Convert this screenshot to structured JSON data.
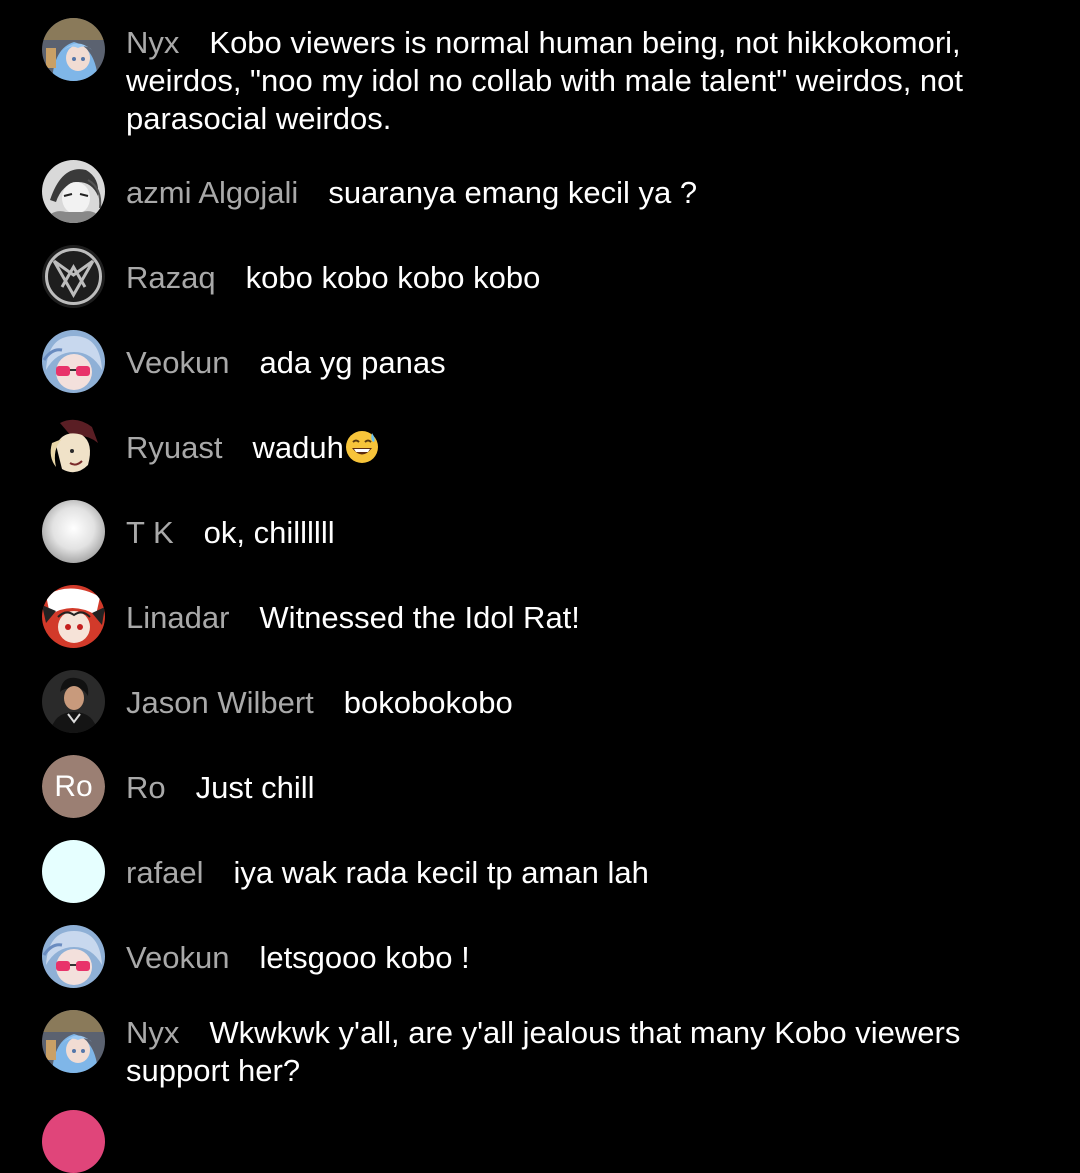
{
  "chat": {
    "messages": [
      {
        "author": "Nyx",
        "text": "Kobo viewers is normal human being, not hikkokomori, weirdos, \"noo my idol no collab with male talent\" weirdos, not parasocial weirdos.",
        "avatar": "blue-haired-anime-avatar"
      },
      {
        "author": "azmi Algojali",
        "text": "suaranya emang kecil ya ?",
        "avatar": "grayscale-manga-avatar"
      },
      {
        "author": "Razaq",
        "text": "kobo kobo kobo kobo",
        "avatar": "geometric-logo-avatar"
      },
      {
        "author": "Veokun",
        "text": "ada yg panas",
        "avatar": "anime-sunglasses-avatar"
      },
      {
        "author": "Ryuast",
        "text": "waduh",
        "avatar": "dark-anime-avatar",
        "emoji": "grinning-sweat-emoji"
      },
      {
        "author": "T K",
        "text": "ok, chillllll",
        "avatar": "white-blur-avatar"
      },
      {
        "author": "Linadar",
        "text": "Witnessed the Idol Rat!",
        "avatar": "red-white-anime-avatar"
      },
      {
        "author": "Jason Wilbert",
        "text": "bokobokobo",
        "avatar": "person-photo-avatar"
      },
      {
        "author": "Ro",
        "text": "Just chill",
        "avatar": "initials-avatar",
        "initials": "Ro"
      },
      {
        "author": "rafael",
        "text": "iya wak rada kecil tp aman lah",
        "avatar": "plain-light-cyan-avatar"
      },
      {
        "author": "Veokun",
        "text": "letsgooo kobo !",
        "avatar": "anime-sunglasses-avatar"
      },
      {
        "author": "Nyx",
        "text": "Wkwkwk y'all, are y'all jealous that many Kobo viewers support her?",
        "avatar": "blue-haired-anime-avatar"
      }
    ]
  },
  "colors": {
    "background": "#000000",
    "author_name": "#a9a9a9",
    "message_text": "#ffffff",
    "initials_avatar_bg": "#9b7f73"
  }
}
